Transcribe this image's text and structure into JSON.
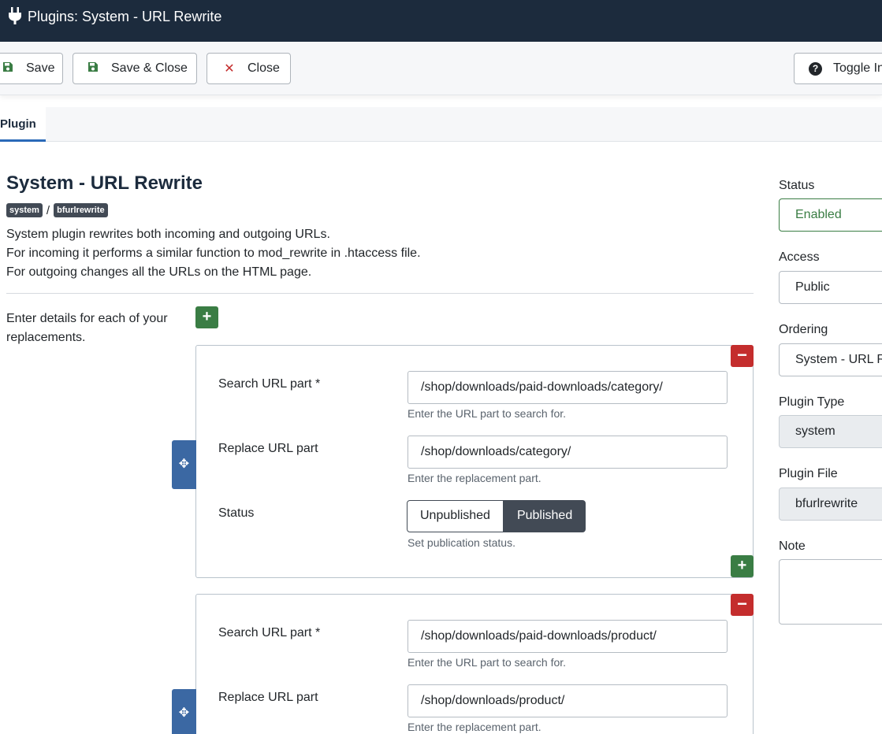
{
  "header": {
    "title": "Plugins: System - URL Rewrite",
    "icon": "plug-icon"
  },
  "toolbar": {
    "save_label": "Save",
    "save_close_label": "Save & Close",
    "close_label": "Close",
    "toggle_label": "Toggle In"
  },
  "tabs": [
    {
      "label": "Plugin"
    }
  ],
  "plugin": {
    "title": "System - URL Rewrite",
    "folder_badge": "system",
    "separator": "/",
    "element_badge": "bfurlrewrite",
    "description": [
      "System plugin rewrites both incoming and outgoing URLs.",
      "For incoming it performs a similar function to mod_rewrite in .htaccess file.",
      "For outgoing changes all the URLs on the HTML page."
    ]
  },
  "replacements": {
    "label": "Enter details for each of your replacements.",
    "items": [
      {
        "search_label": "Search URL part *",
        "search_value": "/shop/downloads/paid-downloads/category/",
        "search_help": "Enter the URL part to search for.",
        "replace_label": "Replace URL part",
        "replace_value": "/shop/downloads/category/",
        "replace_help": "Enter the replacement part.",
        "status_label": "Status",
        "status_off": "Unpublished",
        "status_on": "Published",
        "status_help": "Set publication status."
      },
      {
        "search_label": "Search URL part *",
        "search_value": "/shop/downloads/paid-downloads/product/",
        "search_help": "Enter the URL part to search for.",
        "replace_label": "Replace URL part",
        "replace_value": "/shop/downloads/product/",
        "replace_help": "Enter the replacement part."
      }
    ]
  },
  "sidebar": {
    "status_label": "Status",
    "status_value": "Enabled",
    "access_label": "Access",
    "access_value": "Public",
    "ordering_label": "Ordering",
    "ordering_value": "System - URL Rewrite",
    "type_label": "Plugin Type",
    "type_value": "system",
    "file_label": "Plugin File",
    "file_value": "bfurlrewrite",
    "note_label": "Note",
    "note_value": ""
  },
  "colors": {
    "header_bg": "#1c2b3d",
    "success": "#3a7d44",
    "danger": "#c42d2d",
    "move": "#3b68a3",
    "accent": "#2a69b8"
  }
}
